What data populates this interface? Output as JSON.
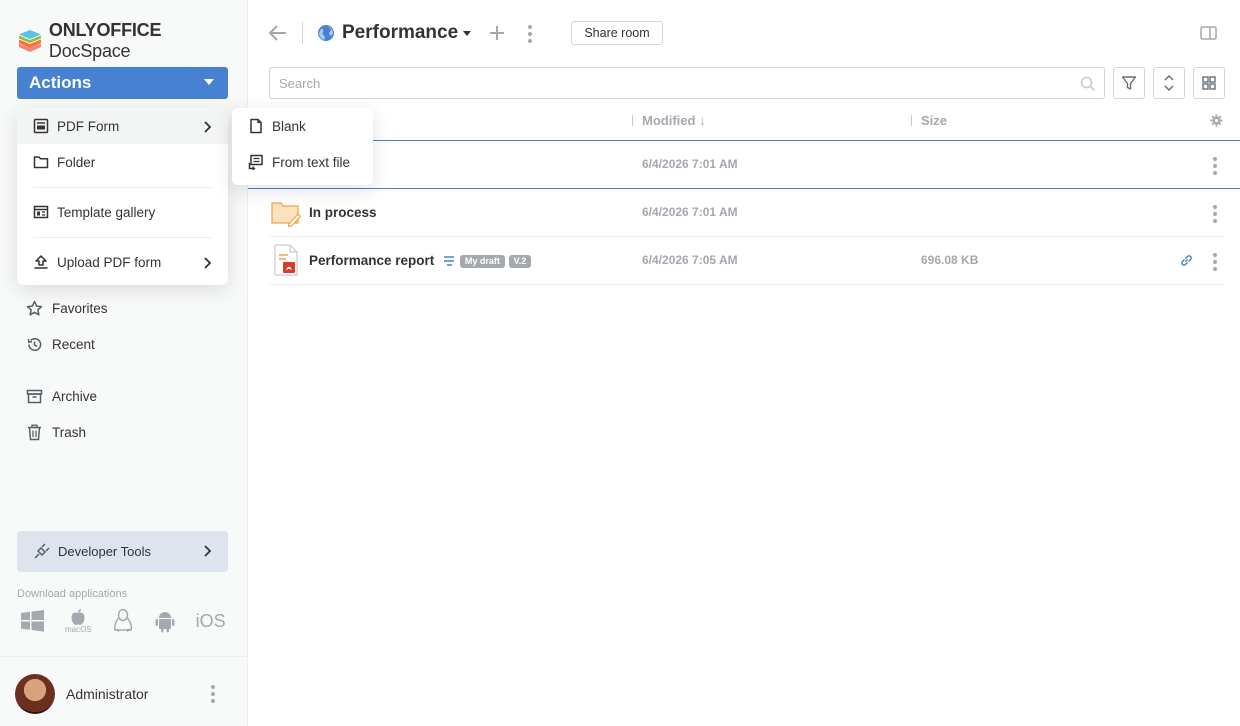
{
  "app": {
    "logo_bold": "ONLYOFFICE",
    "logo_light": " DocSpace",
    "actions_label": "Actions",
    "accent": "#4781d1"
  },
  "sidebar": {
    "items": [
      {
        "label": "Favorites",
        "icon": "star-icon"
      },
      {
        "label": "Recent",
        "icon": "history-icon"
      },
      {
        "label": "Archive",
        "icon": "archive-icon"
      },
      {
        "label": "Trash",
        "icon": "trash-icon"
      }
    ],
    "developer_tools": "Developer Tools",
    "download_label": "Download applications",
    "apps": [
      "windows-icon",
      "macos-icon",
      "linux-icon",
      "android-icon",
      "iOS"
    ],
    "macos_caption": "macOS",
    "ios_label": "iOS",
    "user_name": "Administrator"
  },
  "actions_menu": {
    "items": [
      {
        "label": "PDF Form",
        "icon": "form-icon",
        "has_submenu": true
      },
      {
        "label": "Folder",
        "icon": "folder-icon"
      },
      {
        "label": "Template gallery",
        "icon": "template-gallery-icon"
      },
      {
        "label": "Upload PDF form",
        "icon": "upload-icon",
        "has_submenu": true
      }
    ],
    "submenu": [
      {
        "label": "Blank",
        "icon": "blank-file-icon"
      },
      {
        "label": "From text file",
        "icon": "from-text-file-icon"
      }
    ]
  },
  "header": {
    "room_title": "Performance",
    "share_label": "Share room",
    "search_placeholder": "Search"
  },
  "table": {
    "columns": [
      "Modified",
      "Size"
    ],
    "sort_indicator": "↓",
    "rows": [
      {
        "name": "",
        "modified": "6/4/2026 7:01 AM",
        "size": "",
        "selected": true
      },
      {
        "name": "In process",
        "modified": "6/4/2026 7:01 AM",
        "size": "",
        "type": "folder"
      },
      {
        "name": "Performance report",
        "modified": "6/4/2026 7:05 AM",
        "size": "696.08 KB",
        "type": "pdf",
        "badges": [
          "My draft",
          "V.2"
        ]
      }
    ]
  }
}
